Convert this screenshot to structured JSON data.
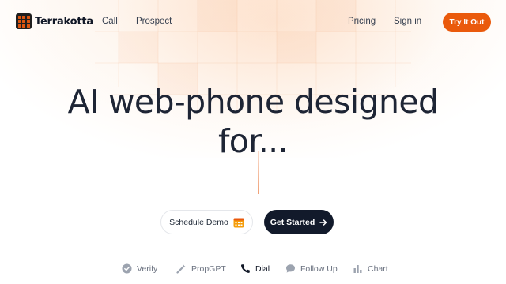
{
  "brand": {
    "name": "Terrakotta",
    "accent": "#ea5a0c",
    "dark": "#121a2b"
  },
  "nav": {
    "links": [
      "Call",
      "Prospect"
    ],
    "right_links": [
      "Pricing",
      "Sign in"
    ],
    "cta_label": "Try It Out"
  },
  "hero": {
    "title_line1": "AI web-phone designed",
    "title_line2": "for..."
  },
  "actions": {
    "demo_label": "Schedule Demo",
    "demo_icon": "calendar-icon",
    "start_label": "Get Started",
    "start_icon": "arrow-right-icon"
  },
  "features": {
    "active": "Dial",
    "tabs": [
      {
        "label": "Verify",
        "icon": "check-circle-icon"
      },
      {
        "label": "PropGPT",
        "icon": "wand-icon"
      },
      {
        "label": "Dial",
        "icon": "phone-icon"
      },
      {
        "label": "Follow Up",
        "icon": "chat-bubble-icon"
      },
      {
        "label": "Chart",
        "icon": "bar-chart-icon"
      }
    ]
  }
}
